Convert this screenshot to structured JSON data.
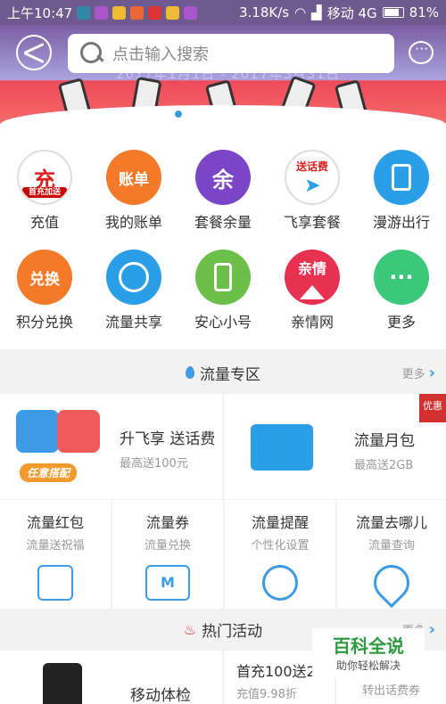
{
  "status": {
    "time": "上午10:47",
    "speed": "3.18K/s",
    "carrier": "移动 4G",
    "battery": "81%"
  },
  "banner": {
    "text": "2017年1月1日 - 2017年3月31日"
  },
  "search": {
    "placeholder": "点击输入搜索"
  },
  "grid": [
    {
      "label": "充值",
      "icon": "充",
      "sub": "首充加送",
      "color": "#ffffff"
    },
    {
      "label": "我的账单",
      "icon": "账单",
      "color": "#f47a2a"
    },
    {
      "label": "套餐余量",
      "icon": "余",
      "color": "#7b45c8"
    },
    {
      "label": "飞享套餐",
      "icon": "送话费",
      "color": "#ffffff"
    },
    {
      "label": "漫游出行",
      "icon": "",
      "color": "#2a9fe8"
    },
    {
      "label": "积分兑换",
      "icon": "兑换",
      "color": "#f47a2a"
    },
    {
      "label": "流量共享",
      "icon": "",
      "color": "#2a9fe8"
    },
    {
      "label": "安心小号",
      "icon": "",
      "color": "#6cc04a"
    },
    {
      "label": "亲情网",
      "icon": "亲情",
      "color": "#e83050"
    },
    {
      "label": "更多",
      "icon": "···",
      "color": "#3cc87a"
    }
  ],
  "sections": {
    "flow": {
      "title": "流量专区",
      "more": "更多"
    },
    "hot": {
      "title": "热门活动",
      "more": "更多"
    }
  },
  "cards": {
    "upgrade": {
      "title": "升飞享 送话费",
      "sub": "最高送100元",
      "tag": "任意搭配"
    },
    "monthly": {
      "title": "流量月包",
      "sub": "最高送2GB",
      "badge": "优惠"
    },
    "small": [
      {
        "title": "流量红包",
        "sub": "流量送祝福"
      },
      {
        "title": "流量券",
        "sub": "流量兑换",
        "icon": "M"
      },
      {
        "title": "流量提醒",
        "sub": "个性化设置"
      },
      {
        "title": "流量去哪儿",
        "sub": "流量查询"
      }
    ],
    "hot": [
      {
        "title": "移动体检"
      },
      {
        "title": "首充100送2",
        "sub": "充值9.98折"
      },
      {
        "sub": "转出话费券"
      }
    ]
  },
  "watermark": {
    "line1": "百科全说",
    "line2": "助你轻松解决"
  }
}
